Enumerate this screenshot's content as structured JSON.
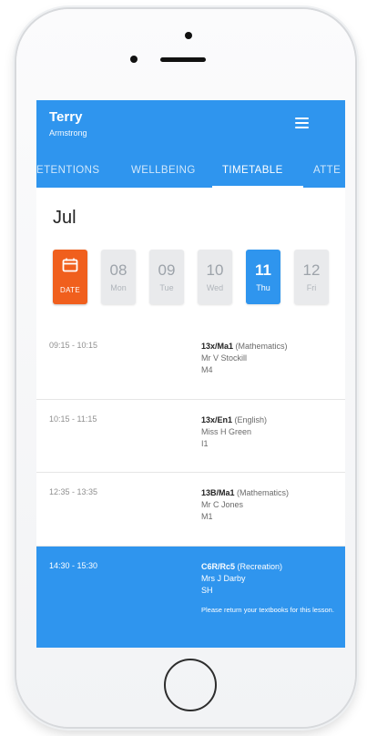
{
  "app": {
    "user": {
      "name": "Terry",
      "subtitle": "Armstrong"
    },
    "tabs": [
      {
        "label": "ETENTIONS"
      },
      {
        "label": "WELLBEING"
      },
      {
        "label": "TIMETABLE"
      },
      {
        "label": "ATTE"
      }
    ],
    "active_tab": "TIMETABLE"
  },
  "calendar": {
    "month": "Jul",
    "date_button_label": "DATE",
    "days": [
      {
        "num": "08",
        "weekday": "Mon"
      },
      {
        "num": "09",
        "weekday": "Tue"
      },
      {
        "num": "10",
        "weekday": "Wed"
      },
      {
        "num": "11",
        "weekday": "Thu"
      },
      {
        "num": "12",
        "weekday": "Fri"
      }
    ],
    "selected_day": "11"
  },
  "lessons": [
    {
      "time": "09:15 - 10:15",
      "code": "13x/Ma1",
      "subject": "(Mathematics)",
      "teacher": "Mr V Stockill",
      "room": "M4"
    },
    {
      "time": "10:15 - 11:15",
      "code": "13x/En1",
      "subject": "(English)",
      "teacher": "Miss H Green",
      "room": "I1"
    },
    {
      "time": "12:35 - 13:35",
      "code": "13B/Ma1",
      "subject": "(Mathematics)",
      "teacher": "Mr C Jones",
      "room": "M1"
    },
    {
      "time": "14:30 - 15:30",
      "code": "C6R/Rc5",
      "subject": "(Recreation)",
      "teacher": "Mrs J Darby",
      "room": "SH",
      "note": "Please return your textbooks for this lesson."
    }
  ],
  "colors": {
    "primary": "#2f95ee",
    "accent": "#f05f1d",
    "day_inactive": "#e9eaec"
  },
  "icons": {
    "menu": "menu-icon",
    "calendar": "calendar-icon"
  }
}
